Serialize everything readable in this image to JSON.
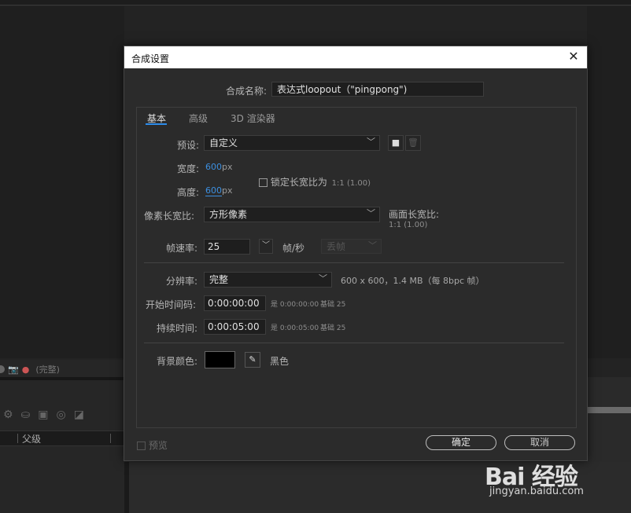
{
  "background": {
    "timeline_icons": [
      "camera-icon",
      "color-wheel-icon"
    ],
    "timeline_label": "(完整)",
    "column_label": "父级"
  },
  "dialog": {
    "title": "合成设置",
    "close_glyph": "✕",
    "name_label": "合成名称:",
    "name_value": "表达式loopout（\"pingpong\")",
    "tabs": [
      "基本",
      "高级",
      "3D 渲染器"
    ],
    "active_tab": "基本",
    "preset": {
      "label": "预设:",
      "value": "自定义"
    },
    "width": {
      "label": "宽度:",
      "value": "600",
      "unit": "px"
    },
    "height": {
      "label": "高度:",
      "value": "600",
      "unit": "px"
    },
    "lock_aspect": {
      "label": "锁定长宽比为",
      "ratio": "1:1 (1.00)",
      "checked": false
    },
    "pixel_aspect": {
      "label": "像素长宽比:",
      "value": "方形像素"
    },
    "frame_aspect": {
      "label": "画面长宽比:",
      "value": "1:1 (1.00)"
    },
    "frame_rate": {
      "label": "帧速率:",
      "value": "25",
      "unit": "帧/秒",
      "drop_frame": "丢帧"
    },
    "resolution": {
      "label": "分辨率:",
      "value": "完整",
      "info": "600 x 600，1.4 MB（每 8bpc 帧）"
    },
    "start_timecode": {
      "label": "开始时间码:",
      "value": "0:00:00:00",
      "note": "是 0:00:00:00",
      "base": "基础 25"
    },
    "duration": {
      "label": "持续时间:",
      "value": "0:00:05:00",
      "note": "是 0:00:05:00",
      "base": "基础 25"
    },
    "background_color": {
      "label": "背景颜色:",
      "name": "黑色",
      "color": "#000000"
    },
    "preview_label": "预览",
    "ok_label": "确定",
    "cancel_label": "取消",
    "accent_color": "#2d8ceb"
  },
  "watermark": {
    "logo": "Bai 经验",
    "url": "jingyan.baidu.com"
  }
}
